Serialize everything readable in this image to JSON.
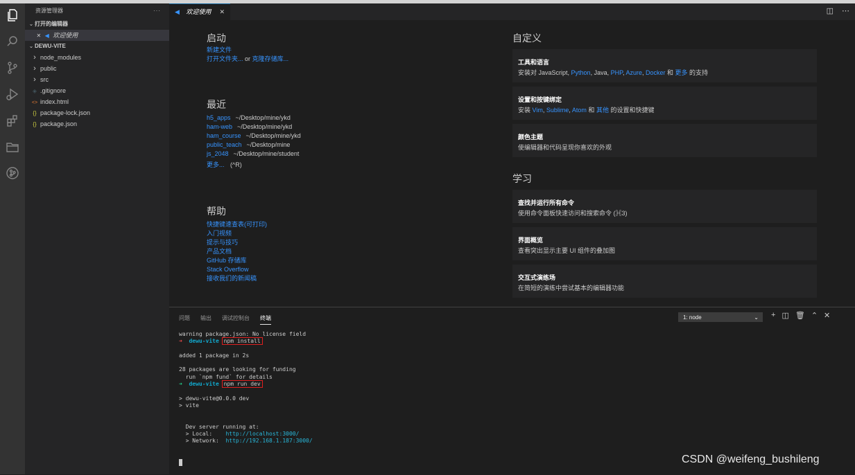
{
  "sidebar": {
    "title": "资源管理器",
    "more": "···",
    "open_editors_title": "打开的编辑器",
    "open_editor_close": "✕",
    "open_editor_item": "欢迎使用",
    "project_title": "DEWU-VITE",
    "files": [
      {
        "name": "node_modules",
        "kind": "folder"
      },
      {
        "name": "public",
        "kind": "folder"
      },
      {
        "name": "src",
        "kind": "folder"
      },
      {
        "name": ".gitignore",
        "kind": "gitignore"
      },
      {
        "name": "index.html",
        "kind": "html"
      },
      {
        "name": "package-lock.json",
        "kind": "json"
      },
      {
        "name": "package.json",
        "kind": "json"
      }
    ]
  },
  "tab": {
    "label": "欢迎使用",
    "close": "✕"
  },
  "welcome": {
    "start": {
      "heading": "启动",
      "new_file": "新建文件",
      "open_folder": "打开文件夹...",
      "or": "or",
      "clone": "克隆存储库..."
    },
    "recent": {
      "heading": "最近",
      "items": [
        {
          "name": "h5_apps",
          "path": "~/Desktop/mine/ykd"
        },
        {
          "name": "ham-web",
          "path": "~/Desktop/mine/ykd"
        },
        {
          "name": "ham_course",
          "path": "~/Desktop/mine/ykd"
        },
        {
          "name": "public_teach",
          "path": "~/Desktop/mine"
        },
        {
          "name": "js_2048",
          "path": "~/Desktop/mine/student"
        }
      ],
      "more": "更多...",
      "more_shortcut": "(^R)"
    },
    "help": {
      "heading": "帮助",
      "links": [
        "快捷键速查表(可打印)",
        "入门视频",
        "提示与技巧",
        "产品文档",
        "GitHub 存储库",
        "Stack Overflow",
        "接收我们的新闻稿"
      ]
    },
    "customize": {
      "heading": "自定义",
      "tools": {
        "title": "工具和语言",
        "prefix": "安装对 JavaScript, ",
        "python": "Python",
        "sep1": ", Java, ",
        "php": "PHP",
        "sep2": ", ",
        "azure": "Azure",
        "sep3": ", ",
        "docker": "Docker",
        "and": " 和 ",
        "more": "更多",
        "suffix": " 的支持"
      },
      "keys": {
        "title": "设置和按键绑定",
        "prefix": "安装 ",
        "vim": "Vim",
        "sep1": ", ",
        "sublime": "Sublime",
        "sep2": ", ",
        "atom": "Atom",
        "and": " 和 ",
        "other": "其他",
        "suffix": " 的设置和快捷键"
      },
      "theme": {
        "title": "颜色主题",
        "desc": "使编辑器和代码呈现你喜欢的外观"
      }
    },
    "learn": {
      "heading": "学习",
      "cards": [
        {
          "title": "查找并运行所有命令",
          "desc": "使用命令面板快速访问和搜索命令 (⌘3)"
        },
        {
          "title": "界面概览",
          "desc": "查看突出显示主要 UI 组件的叠加图"
        },
        {
          "title": "交互式演练场",
          "desc": "在简短的演练中尝试基本的编辑器功能"
        }
      ]
    }
  },
  "panel": {
    "tabs": [
      "问题",
      "输出",
      "调试控制台",
      "终端"
    ],
    "terminal_select": "1: node",
    "terminal": {
      "l1": "warning package.json: No license field",
      "arrow_red": "➜",
      "prompt_dir": "dewu-vite",
      "cmd1": "npm install",
      "l3": "added 1 package in 2s",
      "l5": "28 packages are looking for funding",
      "l6": "  run `npm fund` for details",
      "arrow_green": "➜",
      "cmd2": "npm run dev",
      "l9": "> dewu-vite@0.0.0 dev",
      "l10": "> vite",
      "l13": "  Dev server running at:",
      "local_label": "  > Local:    ",
      "local_url": "http://localhost:3000/",
      "network_label": "  > Network:  ",
      "network_url": "http://192.168.1.187:3000/"
    }
  },
  "watermark": "CSDN @weifeng_bushileng"
}
